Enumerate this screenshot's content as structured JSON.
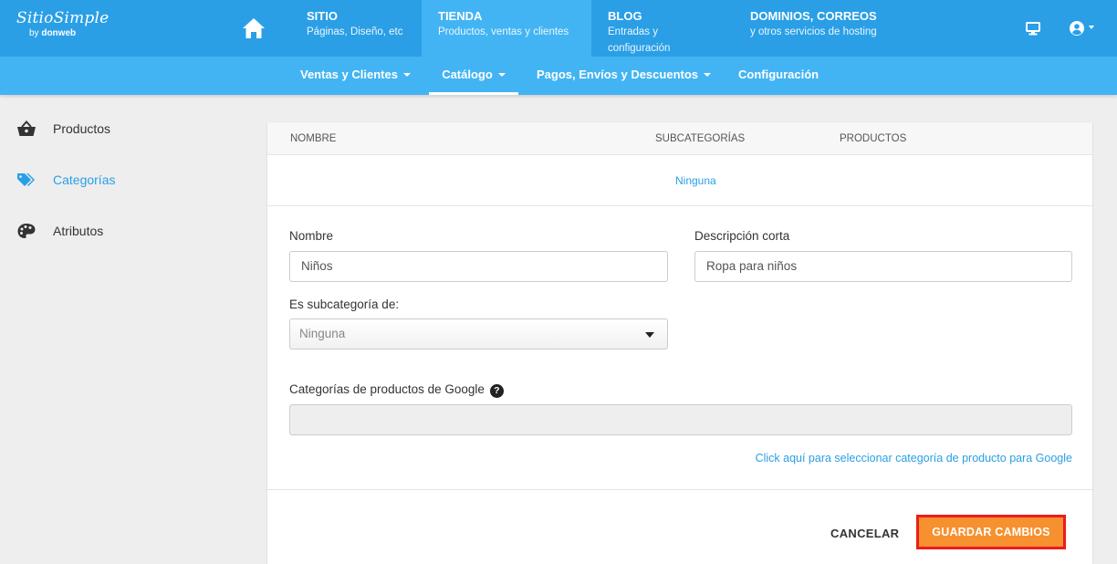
{
  "app": {
    "logo_text": "SitioSimple",
    "logo_by": "by",
    "logo_company": "donweb"
  },
  "topnav": {
    "items": [
      {
        "title": "SITIO",
        "subtitle": "Páginas, Diseño, etc"
      },
      {
        "title": "TIENDA",
        "subtitle": "Productos, ventas y clientes"
      },
      {
        "title": "BLOG",
        "subtitle": "Entradas y configuración"
      },
      {
        "title": "DOMINIOS, CORREOS",
        "subtitle": "y otros servicios de hosting"
      }
    ],
    "active": "TIENDA"
  },
  "subnav": {
    "items": [
      {
        "label": "Ventas y Clientes"
      },
      {
        "label": "Catálogo"
      },
      {
        "label": "Pagos, Envíos y Descuentos"
      },
      {
        "label": "Configuración"
      }
    ],
    "active": "Catálogo"
  },
  "sidebar": {
    "items": [
      {
        "label": "Productos",
        "icon": "basket-icon"
      },
      {
        "label": "Categorías",
        "icon": "tags-icon"
      },
      {
        "label": "Atributos",
        "icon": "palette-icon"
      }
    ],
    "active": "Categorías"
  },
  "table": {
    "columns": [
      "NOMBRE",
      "SUBCATEGORÍAS",
      "PRODUCTOS"
    ],
    "empty_row": "Ninguna"
  },
  "form": {
    "nombre_label": "Nombre",
    "nombre_value": "Niños",
    "descripcion_label": "Descripción corta",
    "descripcion_value": "Ropa para niños",
    "subcategoria_label": "Es subcategoría de:",
    "subcategoria_value": "Ninguna",
    "google_label": "Categorías de productos de Google",
    "google_help": "?",
    "google_value": "",
    "google_link": "Click aquí para seleccionar categoría de producto para Google"
  },
  "actions": {
    "cancel_label": "CANCELAR",
    "save_label": "GUARDAR CAMBIOS"
  },
  "colors": {
    "topbar": "#2a9fe6",
    "subnav": "#43b4f3",
    "accent_link": "#2a9fe6",
    "save_button": "#f7902e",
    "highlight_border": "#ee1b1b"
  }
}
